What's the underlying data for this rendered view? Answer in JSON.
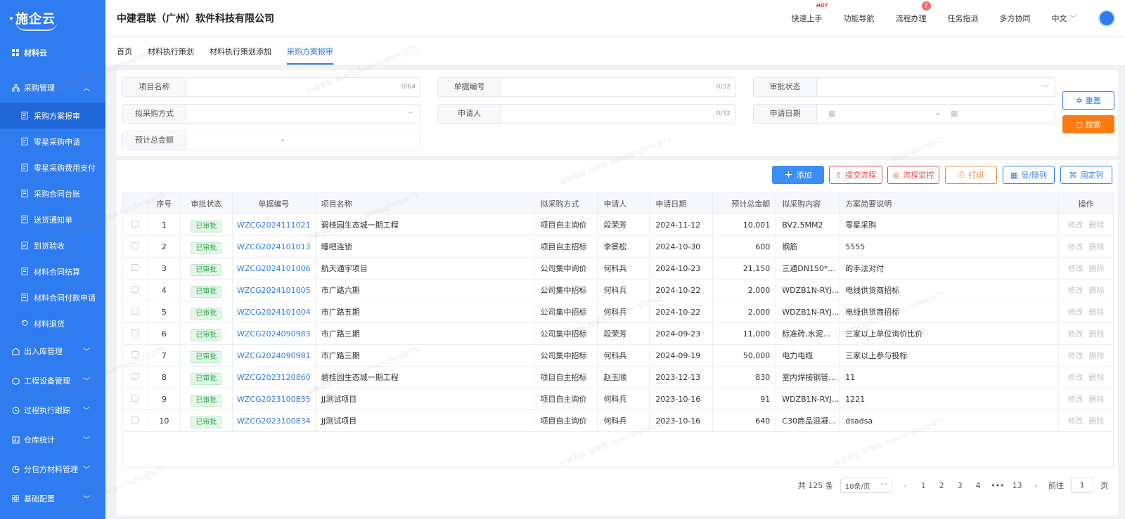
{
  "brand": {
    "logo": "施企云"
  },
  "header": {
    "company": "中建君联（广州）软件科技有限公司",
    "menu": [
      {
        "label": "快速上手",
        "hot": "HOT"
      },
      {
        "label": "功能导航"
      },
      {
        "label": "流程办理",
        "badge": "7"
      },
      {
        "label": "任务指派"
      },
      {
        "label": "多方协同"
      },
      {
        "label": "中文"
      }
    ]
  },
  "sidebar": {
    "top": "材料云",
    "group1": "采购管理",
    "subs": [
      "采购方案报审",
      "零星采购申请",
      "零星采购费用支付",
      "采购合同台账",
      "送货通知单",
      "到货验收",
      "材料合同结算",
      "材料合同付款申请",
      "材料退货"
    ],
    "groups": [
      "出入库管理",
      "工程设备管理",
      "过程执行跟踪",
      "仓库统计",
      "分包方材料管理",
      "基础配置"
    ]
  },
  "tabs": [
    "首页",
    "材料执行策划",
    "材料执行策划添加",
    "采购方案报审"
  ],
  "filter": {
    "project_name": "项目名称",
    "project_cnt": "0/64",
    "doc_no": "单据编号",
    "doc_cnt": "0/32",
    "approval": "审批状态",
    "method": "拟采购方式",
    "applicant": "申请人",
    "applicant_cnt": "0/32",
    "apply_date": "申请日期",
    "date_sep": "-",
    "total": "预计总金额",
    "total_sep": "-",
    "reset": "重置",
    "search": "搜索"
  },
  "toolbar": {
    "add": "添加",
    "submit": "提交流程",
    "monitor": "流程监控",
    "print": "打印",
    "toggle": "显/隐列",
    "fix": "固定列"
  },
  "table": {
    "headers": [
      "序号",
      "审批状态",
      "单据编号",
      "项目名称",
      "拟采购方式",
      "申请人",
      "申请日期",
      "预计总金额",
      "拟采购内容",
      "方案简要说明",
      "操作"
    ],
    "edit": "修改",
    "del": "删除",
    "rows": [
      {
        "n": "1",
        "s": "已审批",
        "no": "WZCG2024111021",
        "p": "碧桂园生态城一期工程",
        "m": "项目自主询价",
        "a": "段荣芳",
        "d": "2024-11-12",
        "t": "10,001",
        "c": "BV2.5MM2",
        "x": "零星采购"
      },
      {
        "n": "2",
        "s": "已审批",
        "no": "WZCG2024101013",
        "p": "睡吧连锁",
        "m": "项目自主招标",
        "a": "李景松",
        "d": "2024-10-30",
        "t": "600",
        "c": "钢筋",
        "x": "5555"
      },
      {
        "n": "3",
        "s": "已审批",
        "no": "WZCG2024101006",
        "p": "航天通宇项目",
        "m": "公司集中询价",
        "a": "何科兵",
        "d": "2024-10-23",
        "t": "21,150",
        "c": "三通DN150*...",
        "x": "的手法对付"
      },
      {
        "n": "4",
        "s": "已审批",
        "no": "WZCG2024101005",
        "p": "市广路六期",
        "m": "公司集中招标",
        "a": "何科兵",
        "d": "2024-10-22",
        "t": "2,000",
        "c": "WDZB1N-RYJ...",
        "x": "电线供货商招标"
      },
      {
        "n": "5",
        "s": "已审批",
        "no": "WZCG2024101004",
        "p": "市广路五期",
        "m": "公司集中招标",
        "a": "何科兵",
        "d": "2024-10-22",
        "t": "2,000",
        "c": "WDZB1N-RYJ...",
        "x": "电线供货商招标"
      },
      {
        "n": "6",
        "s": "已审批",
        "no": "WZCG2024090983",
        "p": "市广路三期",
        "m": "公司集中招标",
        "a": "段荣芳",
        "d": "2024-09-23",
        "t": "11,000",
        "c": "标准砖,水泥...",
        "x": "三家以上单位询价比价"
      },
      {
        "n": "7",
        "s": "已审批",
        "no": "WZCG2024090981",
        "p": "市广路三期",
        "m": "公司集中招标",
        "a": "何科兵",
        "d": "2024-09-19",
        "t": "50,000",
        "c": "电力电缆",
        "x": "三家以上参与投标"
      },
      {
        "n": "8",
        "s": "已审批",
        "no": "WZCG2023120860",
        "p": "碧桂园生态城一期工程",
        "m": "项目自主招标",
        "a": "赵玉顺",
        "d": "2023-12-13",
        "t": "830",
        "c": "室内焊接钢管...",
        "x": "11"
      },
      {
        "n": "9",
        "s": "已审批",
        "no": "WZCG2023100835",
        "p": "JJ测试项目",
        "m": "项目自主询价",
        "a": "何科兵",
        "d": "2023-10-16",
        "t": "91",
        "c": "WDZB1N-RYJ...",
        "x": "1221"
      },
      {
        "n": "10",
        "s": "已审批",
        "no": "WZCG2023100834",
        "p": "JJ测试项目",
        "m": "项目自主询价",
        "a": "何科兵",
        "d": "2023-10-16",
        "t": "640",
        "c": "C30商品混凝...",
        "x": "dsadsa"
      }
    ]
  },
  "pager": {
    "total": "共 125 条",
    "size": "10条/页",
    "pages": [
      "1",
      "2",
      "3",
      "4",
      "•••",
      "13"
    ],
    "goto": "前往",
    "page": "1",
    "unit": "页"
  },
  "watermark": "中建君联 段荣芳-duanrongfang@75"
}
